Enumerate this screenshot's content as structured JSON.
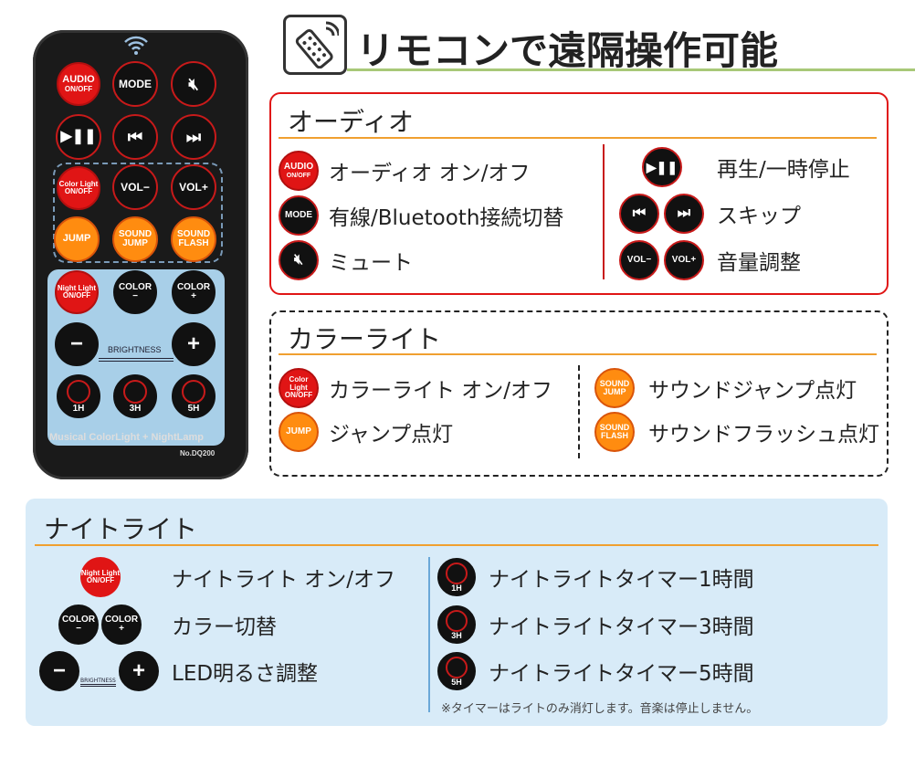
{
  "title": "リモコンで遠隔操作可能",
  "remote": {
    "buttons": {
      "audio": [
        "AUDIO",
        "ON/OFF"
      ],
      "mode": "MODE",
      "play_pause": "▶❚❚",
      "prev": "⏮",
      "next": "⏭",
      "color_light": [
        "Color Light",
        "ON/OFF"
      ],
      "vol_minus": "VOL−",
      "vol_plus": "VOL+",
      "jump": "JUMP",
      "sound_jump": [
        "SOUND",
        "JUMP"
      ],
      "sound_flash": [
        "SOUND",
        "FLASH"
      ],
      "night_light": [
        "Night Light",
        "ON/OFF"
      ],
      "color_minus": [
        "COLOR",
        "−"
      ],
      "color_plus": [
        "COLOR",
        "+"
      ],
      "bright_minus": "−",
      "bright_plus": "+",
      "t1": "1H",
      "t3": "3H",
      "t5": "5H"
    },
    "brightness_label": "BRIGHTNESS",
    "product_name": "Musical ColorLight + NightLamp",
    "model": "No.DQ200"
  },
  "audio": {
    "heading": "オーディオ",
    "items": [
      "オーディオ オン/オフ",
      "有線/Bluetooth接続切替",
      "ミュート",
      "再生/一時停止",
      "スキップ",
      "音量調整"
    ]
  },
  "color_light": {
    "heading": "カラーライト",
    "items": [
      "カラーライト オン/オフ",
      "ジャンプ点灯",
      "サウンドジャンプ点灯",
      "サウンドフラッシュ点灯"
    ]
  },
  "night_light": {
    "heading": "ナイトライト",
    "items": [
      "ナイトライト オン/オフ",
      "カラー切替",
      "LED明るさ調整",
      "ナイトライトタイマー1時間",
      "ナイトライトタイマー3時間",
      "ナイトライトタイマー5時間"
    ],
    "note": "※タイマーはライトのみ消灯します。音楽は停止しません。"
  },
  "colors": {
    "red": "#e01515",
    "orange": "#ff8c10",
    "green_line": "#a8c878",
    "night_bg": "#d8ebf8"
  }
}
